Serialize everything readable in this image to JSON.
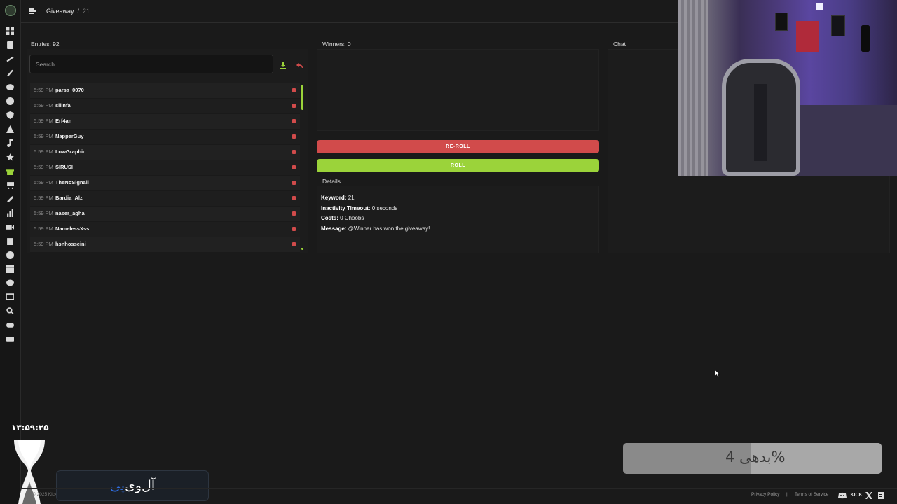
{
  "header": {
    "breadcrumb_root": "Giveaway",
    "breadcrumb_separator": "/",
    "breadcrumb_current": "21"
  },
  "entries": {
    "title": "Entries: 92",
    "search_placeholder": "Search",
    "items": [
      {
        "time": "5:59 PM",
        "user": "parsa_0070"
      },
      {
        "time": "5:59 PM",
        "user": "siiinfa"
      },
      {
        "time": "5:59 PM",
        "user": "Erf4an"
      },
      {
        "time": "5:59 PM",
        "user": "NapperGuy"
      },
      {
        "time": "5:59 PM",
        "user": "LowGraphic"
      },
      {
        "time": "5:59 PM",
        "user": "SIRUSI"
      },
      {
        "time": "5:59 PM",
        "user": "TheNoSignall"
      },
      {
        "time": "5:59 PM",
        "user": "Bardia_Alz"
      },
      {
        "time": "5:59 PM",
        "user": "naser_agha"
      },
      {
        "time": "5:59 PM",
        "user": "NamelessXss"
      },
      {
        "time": "5:59 PM",
        "user": "hsnhosseini"
      }
    ]
  },
  "winners": {
    "title": "Winners: 0"
  },
  "actions": {
    "reroll_label": "RE-ROLL",
    "roll_label": "ROLL"
  },
  "details": {
    "title": "Details",
    "keyword_label": "Keyword:",
    "keyword_value": "21",
    "timeout_label": "Inactivity Timeout:",
    "timeout_value": "0 seconds",
    "costs_label": "Costs:",
    "costs_value": "0 Choobs",
    "message_label": "Message:",
    "message_value": "@Winner has won the giveaway!"
  },
  "chat": {
    "title": "Chat"
  },
  "overlay": {
    "clock": "۱۳:۵۹:۲۵",
    "brand_part1": "آل‌وی",
    "brand_part2": "پی",
    "progress_label": "بدهی 4%",
    "progress_value": 0.04
  },
  "footer": {
    "copyright": "© 2025 Kicklet",
    "privacy": "Privacy Policy",
    "separator": "|",
    "terms": "Terms of Service",
    "kick_label": "KICK"
  },
  "colors": {
    "accent_green": "#9bd33a",
    "danger_red": "#d14b4b",
    "background": "#1a1a1a"
  },
  "rail_icons": [
    "dashboard-icon",
    "document-icon",
    "tools-icon",
    "hammer-icon",
    "chat-icon",
    "clock-icon",
    "shield-icon",
    "warning-icon",
    "music-icon",
    "star-icon",
    "gift-icon",
    "cart-icon",
    "link-icon",
    "chart-icon",
    "video-icon",
    "box-icon",
    "emoji-icon",
    "clapper-icon",
    "comment-icon",
    "monitor-icon",
    "search-icon",
    "gamepad-icon",
    "wallet-icon"
  ]
}
